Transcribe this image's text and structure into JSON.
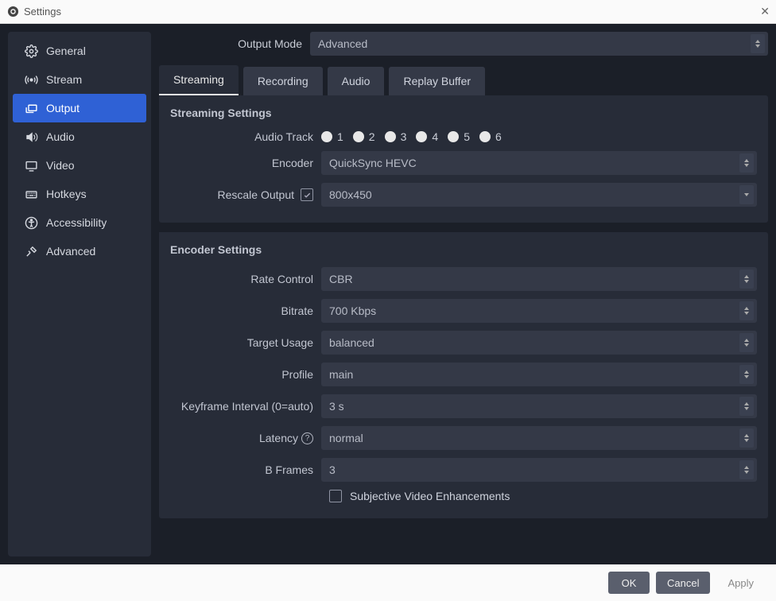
{
  "window": {
    "title": "Settings"
  },
  "sidebar": {
    "items": [
      {
        "label": "General"
      },
      {
        "label": "Stream"
      },
      {
        "label": "Output"
      },
      {
        "label": "Audio"
      },
      {
        "label": "Video"
      },
      {
        "label": "Hotkeys"
      },
      {
        "label": "Accessibility"
      },
      {
        "label": "Advanced"
      }
    ],
    "active_index": 2
  },
  "output_mode": {
    "label": "Output Mode",
    "value": "Advanced"
  },
  "tabs": {
    "items": [
      {
        "label": "Streaming"
      },
      {
        "label": "Recording"
      },
      {
        "label": "Audio"
      },
      {
        "label": "Replay Buffer"
      }
    ],
    "active_index": 0
  },
  "streaming": {
    "title": "Streaming Settings",
    "audio_track": {
      "label": "Audio Track",
      "options": [
        "1",
        "2",
        "3",
        "4",
        "5",
        "6"
      ]
    },
    "encoder": {
      "label": "Encoder",
      "value": "QuickSync HEVC"
    },
    "rescale": {
      "label": "Rescale Output",
      "checked": true,
      "value": "800x450"
    }
  },
  "encoder": {
    "title": "Encoder Settings",
    "rate_control": {
      "label": "Rate Control",
      "value": "CBR"
    },
    "bitrate": {
      "label": "Bitrate",
      "value": "700 Kbps"
    },
    "target_usage": {
      "label": "Target Usage",
      "value": "balanced"
    },
    "profile": {
      "label": "Profile",
      "value": "main"
    },
    "keyframe": {
      "label": "Keyframe Interval (0=auto)",
      "value": "3 s"
    },
    "latency": {
      "label": "Latency",
      "value": "normal"
    },
    "bframes": {
      "label": "B Frames",
      "value": "3"
    },
    "subjective": {
      "label": "Subjective Video Enhancements",
      "checked": false
    }
  },
  "footer": {
    "ok": "OK",
    "cancel": "Cancel",
    "apply": "Apply"
  }
}
